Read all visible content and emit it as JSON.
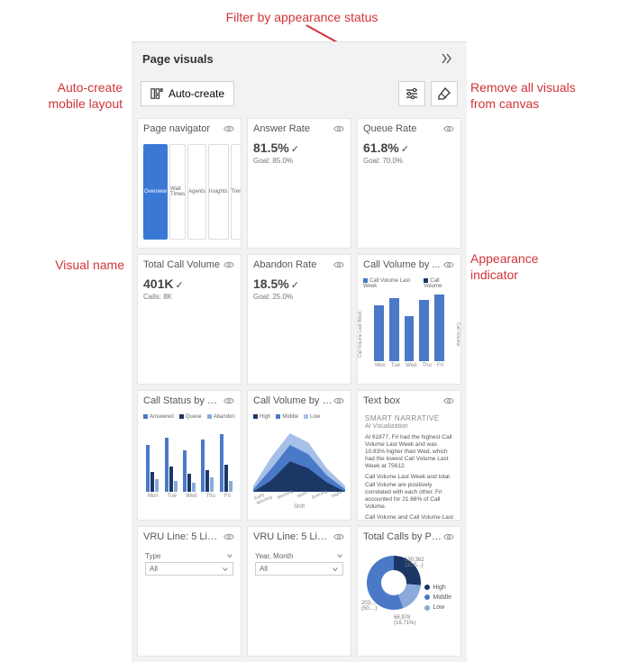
{
  "annotations": {
    "filter_status": "Filter by appearance status",
    "auto_create": "Auto-create\nmobile layout",
    "remove_all": "Remove all visuals\nfrom canvas",
    "visual_name": "Visual name",
    "appearance_ind": "Appearance\nindicator"
  },
  "panel": {
    "title": "Page visuals",
    "auto_create_label": "Auto-create"
  },
  "tiles": [
    {
      "title": "Page navigator",
      "type": "navigator",
      "nav_items": [
        "Overview",
        "Wait Times",
        "Agents",
        "Insights",
        "Trends"
      ],
      "active": 0
    },
    {
      "title": "Answer Rate",
      "type": "kpi",
      "value": "81.5%",
      "goal": "Goal: 85.0%"
    },
    {
      "title": "Queue Rate",
      "type": "kpi",
      "value": "61.8%",
      "goal": "Goal: 70.0%"
    },
    {
      "title": "Total Call Volume",
      "type": "kpi",
      "value": "401K",
      "goal": "Calls: 8K"
    },
    {
      "title": "Abandon Rate",
      "type": "kpi",
      "value": "18.5%",
      "goal": "Goal: 25.0%"
    },
    {
      "title": "Call Volume by ...",
      "type": "columns",
      "legend": [
        "Call Volume Last Week",
        "Call Volume"
      ],
      "x": [
        "Mon",
        "Tue",
        "Wed",
        "Thu",
        "Fri"
      ],
      "heights": [
        62,
        70,
        50,
        68,
        74
      ],
      "yleft": "Call Volume Last Week",
      "yright": "Call Volume"
    },
    {
      "title": "Call Status by W...",
      "type": "grouped",
      "legend": [
        "Answered",
        "Queue",
        "Abandon"
      ],
      "x": [
        "Mon",
        "Tue",
        "Wed",
        "Thu",
        "Fri"
      ],
      "series": [
        [
          52,
          60,
          46,
          58,
          64
        ],
        [
          22,
          28,
          20,
          24,
          30
        ],
        [
          14,
          12,
          10,
          16,
          12
        ]
      ]
    },
    {
      "title": "Call Volume by S...",
      "type": "area",
      "legend": [
        "High",
        "Middle",
        "Low"
      ],
      "x": [
        "Early Morning",
        "Morning",
        "Noon",
        "Evening",
        "Night"
      ],
      "xlabel": "Shift"
    },
    {
      "title": "Text box",
      "type": "text",
      "heading": "SMART NARRATIVE",
      "sub": "AI Visualization",
      "lines": [
        "At 61877, Fri had the highest Call Volume Last Week and was 10.83% higher than Wed, which had the lowest Call Volume Last Week at 75612.",
        "Call Volume Last Week and total Call Volume are positively correlated with each other. Fri accounted for 21.66% of Call Volume.",
        "Call Volume and Call Volume Last Week"
      ]
    },
    {
      "title": "VRU Line: 5 Line...",
      "type": "slicer",
      "field": "Type",
      "selected": "All"
    },
    {
      "title": "VRU Line: 5 Line...",
      "type": "slicer",
      "field": "Year, Month",
      "selected": "All"
    },
    {
      "title": "Total Calls by Pri...",
      "type": "donut",
      "segments": [
        {
          "label": "High",
          "value": "130,362",
          "pct": "(32.5...)"
        },
        {
          "label": "Middle",
          "value": "66,978",
          "pct": "(16.71%)"
        },
        {
          "label": "Low",
          "value": "203,...",
          "pct": "(50....)"
        }
      ]
    }
  ]
}
